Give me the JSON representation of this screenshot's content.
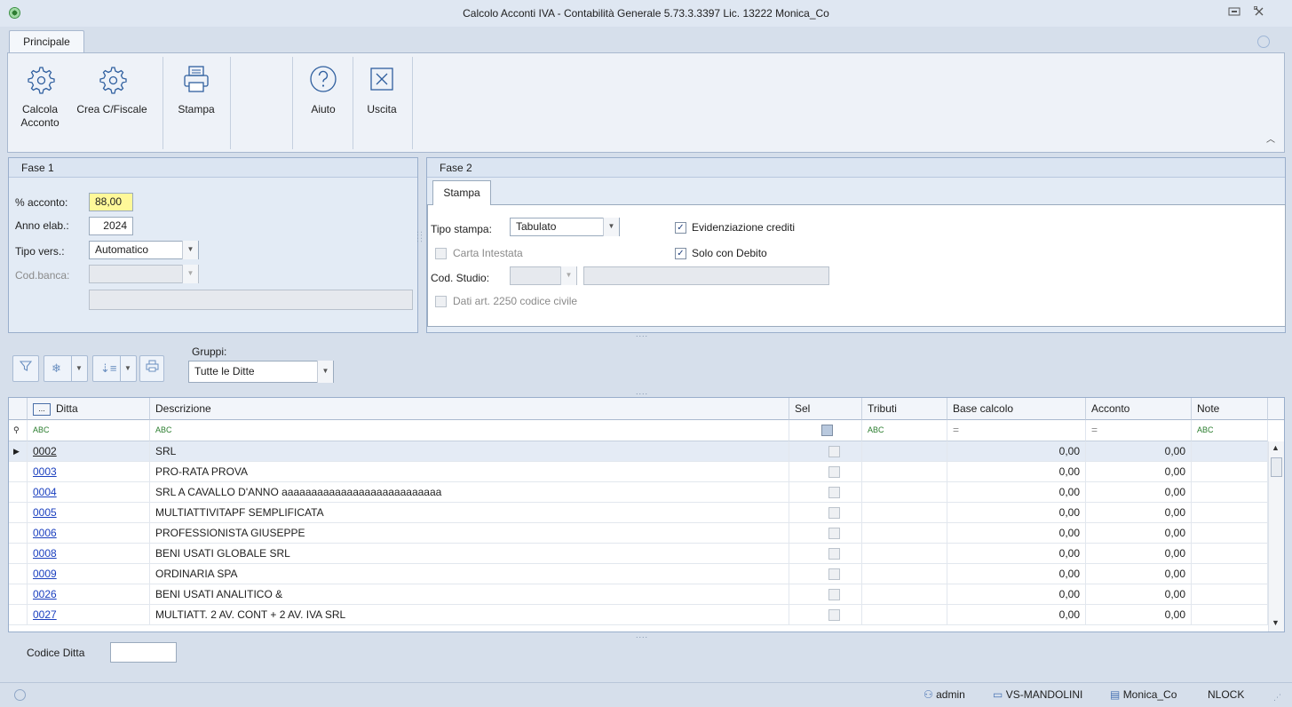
{
  "window": {
    "title": "Calcolo Acconti IVA - Contabilità Generale 5.73.3.3397 Lic. 13222 Monica_Co"
  },
  "ribbon": {
    "tab": "Principale",
    "buttons": [
      {
        "label": "Calcola\nAcconto",
        "icon": "gear-icon"
      },
      {
        "label": "Crea C/Fiscale",
        "icon": "gear-icon"
      },
      {
        "label": "Stampa",
        "icon": "printer-icon"
      },
      {
        "label": "Aiuto",
        "icon": "help-icon"
      },
      {
        "label": "Uscita",
        "icon": "close-box-icon"
      }
    ]
  },
  "fase1": {
    "title": "Fase 1",
    "acconto_label": "% acconto:",
    "acconto_value": "88,00",
    "anno_label": "Anno elab.:",
    "anno_value": "2024",
    "tipo_vers_label": "Tipo vers.:",
    "tipo_vers_value": "Automatico",
    "cod_banca_label": "Cod.banca:",
    "cod_banca_value": "",
    "banca_desc": ""
  },
  "fase2": {
    "title": "Fase 2",
    "tab": "Stampa",
    "tipo_stampa_label": "Tipo stampa:",
    "tipo_stampa_value": "Tabulato",
    "carta_intestata_label": "Carta Intestata",
    "cod_studio_label": "Cod. Studio:",
    "dati_art_label": "Dati art. 2250 codice civile",
    "evidenziazione_label": "Evidenziazione crediti",
    "solo_debito_label": "Solo con Debito",
    "evidenziazione_checked": true,
    "solo_debito_checked": true
  },
  "toolbar": {
    "gruppi_label": "Gruppi:",
    "gruppi_value": "Tutte le Ditte",
    "ellipsis": "....",
    "tools": [
      "filter-icon",
      "snowflake-icon",
      "sort-icon",
      "print-icon"
    ]
  },
  "grid": {
    "columns": [
      "Ditta",
      "Descrizione",
      "Sel",
      "Tributi",
      "Base calcolo",
      "Acconto",
      "Note"
    ],
    "header_button": "...",
    "filter_glyphs": [
      "ABC",
      "ABC",
      "=",
      "=",
      "ABC"
    ],
    "rows": [
      {
        "ditta": "0002",
        "descrizione": "SRL",
        "base": "0,00",
        "acconto": "0,00"
      },
      {
        "ditta": "0003",
        "descrizione": "PRO-RATA PROVA",
        "base": "0,00",
        "acconto": "0,00"
      },
      {
        "ditta": "0004",
        "descrizione": "SRL A CAVALLO D'ANNO  aaaaaaaaaaaaaaaaaaaaaaaaaaa",
        "base": "0,00",
        "acconto": "0,00"
      },
      {
        "ditta": "0005",
        "descrizione": "MULTIATTIVITAPF SEMPLIFICATA",
        "base": "0,00",
        "acconto": "0,00"
      },
      {
        "ditta": "0006",
        "descrizione": "PROFESSIONISTA GIUSEPPE",
        "base": "0,00",
        "acconto": "0,00"
      },
      {
        "ditta": "0008",
        "descrizione": "BENI USATI GLOBALE SRL",
        "base": "0,00",
        "acconto": "0,00"
      },
      {
        "ditta": "0009",
        "descrizione": "ORDINARIA SPA",
        "base": "0,00",
        "acconto": "0,00"
      },
      {
        "ditta": "0026",
        "descrizione": "BENI USATI ANALITICO &",
        "base": "0,00",
        "acconto": "0,00"
      },
      {
        "ditta": "0027",
        "descrizione": "MULTIATT. 2 AV. CONT + 2 AV. IVA SRL",
        "base": "0,00",
        "acconto": "0,00"
      }
    ]
  },
  "footer": {
    "codice_ditta_label": "Codice Ditta",
    "codice_ditta_value": ""
  },
  "status": {
    "user": "admin",
    "machine": "VS-MANDOLINI",
    "database": "Monica_Co",
    "lock": "NLOCK"
  }
}
